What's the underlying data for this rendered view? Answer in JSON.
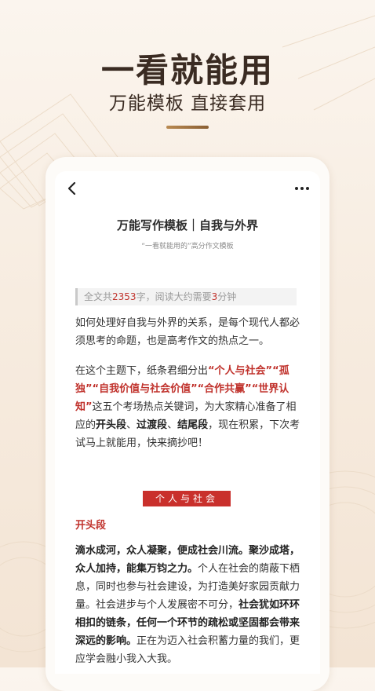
{
  "hero": {
    "title": "一看就能用",
    "subtitle": "万能模板 直接套用"
  },
  "nav": {
    "back_icon": "chevron-left-icon",
    "more_icon": "more-dots-icon"
  },
  "article": {
    "title": "万能写作模板｜自我与外界",
    "subtitle": "“一看就能用的”高分作文模板",
    "read_info": {
      "prefix": "全文共",
      "word_count": "2353",
      "middle": "字，阅读大约需要",
      "minutes": "3",
      "suffix": "分钟"
    },
    "para1": "如何处理好自我与外界的关系，是每个现代人都必须思考的命题，也是高考作文的热点之一。",
    "para2": {
      "a": "在这个主题下，纸条君细分出",
      "k1": "“个人与社会”“孤独”“自我价值与社会价值”“合作共赢”“世界认知”",
      "b": "这五个考场热点关键词，为大家精心准备了相应的",
      "k2": "开头段",
      "c": "、",
      "k3": "过渡段",
      "d": "、",
      "k4": "结尾段",
      "e": "，现在积累，下次考试马上就能用，快来摘抄吧！"
    },
    "section_tag": "个人与社会",
    "sub_heading": "开头段",
    "para3": {
      "b1": "滴水成河，众人凝聚，便成社会川流。聚沙成塔，众人加持，能集万钧之力。",
      "t1": "个人在社会的荫蔽下栖息，同时也参与社会建设，为打造美好家园贡献力量。社会进步与个人发展密不可分，",
      "b2": "社会犹如环环相扣的链条，任何一个环节的疏松或坚固都会带来深远的影响。",
      "t2": "正在为迈入社会积蓄力量的我们，更应学会融小我入大我。"
    }
  },
  "colors": {
    "accent_red": "#c0322c",
    "tag_bg": "#c9302c",
    "hero_text": "#3a2b22",
    "gold": "#b98a52"
  }
}
